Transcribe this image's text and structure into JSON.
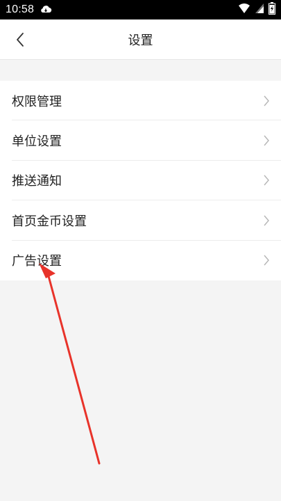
{
  "status_bar": {
    "time": "10:58",
    "icons": [
      "cloud-icon",
      "wifi-icon",
      "signal-icon",
      "battery-icon"
    ]
  },
  "nav": {
    "title": "设置",
    "back_icon": "chevron-left-icon"
  },
  "menu": {
    "items": [
      {
        "label": "权限管理"
      },
      {
        "label": "单位设置"
      },
      {
        "label": "推送通知"
      },
      {
        "label": "首页金币设置"
      },
      {
        "label": "广告设置"
      }
    ],
    "chevron_icon": "chevron-right-icon"
  },
  "colors": {
    "annotation": "#e8332a",
    "background": "#f4f4f4",
    "text": "#222222",
    "chevron": "#b5b5b5"
  }
}
